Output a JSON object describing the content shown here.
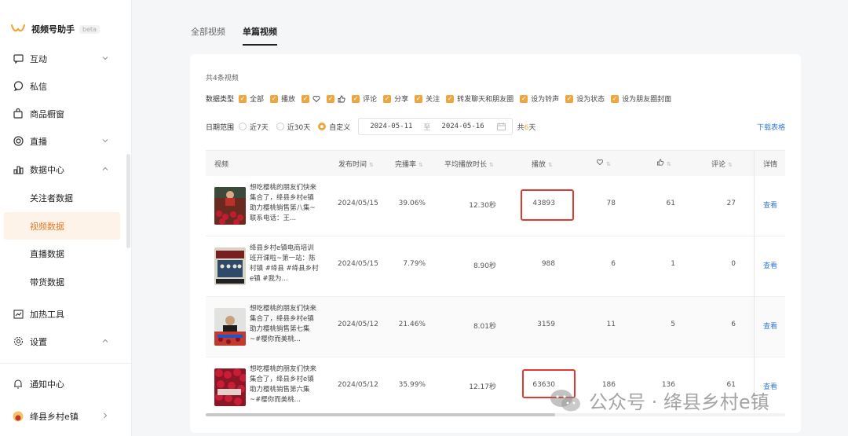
{
  "app": {
    "title": "视频号助手",
    "badge": "beta"
  },
  "sidebar": {
    "items": [
      {
        "label": "互动",
        "icon": "message-square-icon"
      },
      {
        "label": "私信",
        "icon": "chat-bubble-icon"
      },
      {
        "label": "商品橱窗",
        "icon": "shopping-bag-icon"
      },
      {
        "label": "直播",
        "icon": "live-circle-icon"
      },
      {
        "label": "数据中心",
        "icon": "bar-chart-icon"
      },
      {
        "label": "加热工具",
        "icon": "trend-chart-icon"
      },
      {
        "label": "设置",
        "icon": "gear-icon"
      }
    ],
    "sub_items": [
      "关注者数据",
      "视频数据",
      "直播数据",
      "带货数据"
    ],
    "notification": "通知中心",
    "account": "绛县乡村e镇"
  },
  "tabs": [
    "全部视频",
    "单篇视频"
  ],
  "summary": {
    "total": "共4条视频"
  },
  "filters": {
    "label": "数据类型",
    "options": [
      "全部",
      "播放",
      "",
      "",
      "评论",
      "分享",
      "关注",
      "转发聊天和朋友圈",
      "设为铃声",
      "设为状态",
      "设为朋友圈封面"
    ]
  },
  "date_range": {
    "label": "日期范围",
    "options": [
      "近7天",
      "近30天",
      "自定义"
    ],
    "start": "2024-05-11",
    "separator": "至",
    "end": "2024-05-16",
    "days_prefix": "共",
    "days": "6",
    "days_suffix": "天"
  },
  "download": "下载表格",
  "table": {
    "headers": {
      "video": "视频",
      "publish": "发布时间",
      "completion": "完播率",
      "avg_duration": "平均播放时长",
      "plays": "播放",
      "likes": "",
      "thumbs": "",
      "comments": "评论",
      "detail": "详情"
    },
    "rows": [
      {
        "title": "想吃樱桃的朋友们快来集合了，绛县乡村e镇助力樱桃销售第八集~联系电话：王...",
        "date": "2024/05/15",
        "completion": "39.06%",
        "avg": "12.30秒",
        "plays": "43893",
        "likes": "78",
        "thumbs": "61",
        "comments": "27",
        "link": "查看"
      },
      {
        "title": "绛县乡村e镇电商培训班开课啦~第一站：陈村镇 #绛县 #绛县乡村e镇 #我为...",
        "date": "2024/05/15",
        "completion": "7.79%",
        "avg": "8.90秒",
        "plays": "988",
        "likes": "6",
        "thumbs": "1",
        "comments": "0",
        "link": "查看"
      },
      {
        "title": "想吃樱桃的朋友们快来集合了，绛县乡村e镇助力樱桃销售第七集~#樱你而美桃...",
        "date": "2024/05/12",
        "completion": "21.46%",
        "avg": "8.01秒",
        "plays": "3159",
        "likes": "11",
        "thumbs": "5",
        "comments": "6",
        "link": "查看"
      },
      {
        "title": "想吃樱桃的朋友们快来集合了，绛县乡村e镇助力樱桃销售第六集~#樱你而美桃...",
        "date": "2024/05/12",
        "completion": "35.99%",
        "avg": "12.17秒",
        "plays": "63630",
        "likes": "186",
        "thumbs": "136",
        "comments": "61",
        "link": "查看"
      }
    ]
  },
  "watermark": "公众号 · 绛县乡村e镇",
  "colors": {
    "accent": "#f0a640",
    "link": "#3a7bd5",
    "highlight": "#e03a2e"
  }
}
